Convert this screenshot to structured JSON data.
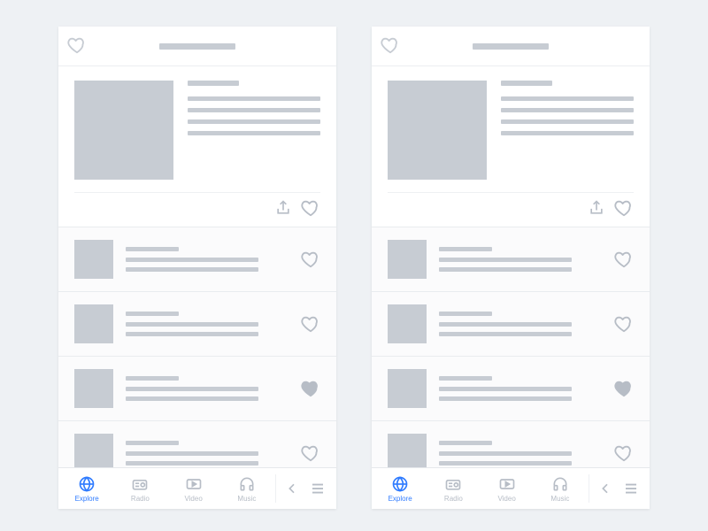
{
  "tabs": {
    "explore": "Explore",
    "radio": "Radio",
    "video": "Video",
    "music": "Music"
  },
  "list": {
    "items": [
      {
        "favorited": false
      },
      {
        "favorited": false
      },
      {
        "favorited": true
      },
      {
        "favorited": false
      }
    ]
  }
}
